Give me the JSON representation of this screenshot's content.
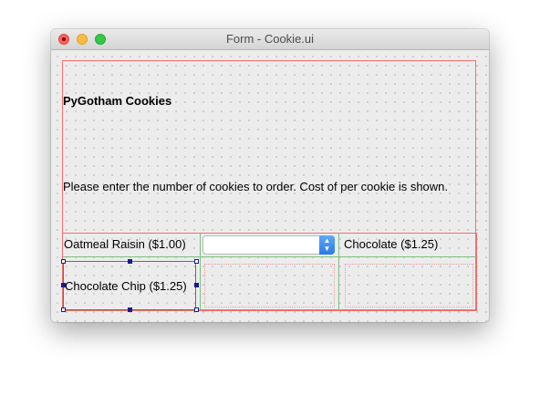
{
  "window": {
    "title": "Form - Cookie.ui"
  },
  "form": {
    "heading": "PyGotham Cookies",
    "instructions": "Please enter the number of cookies to order. Cost of per cookie is shown.",
    "items": [
      {
        "label": "Oatmeal Raisin ($1.00)"
      },
      {
        "label": "Chocolate ($1.25)"
      },
      {
        "label": "Chocolate Chip ($1.25)"
      }
    ],
    "combo_value": ""
  },
  "colors": {
    "layout_outline": "#f0706c",
    "grid_line": "#7cc07c",
    "selection_handle": "#1a1a8a",
    "combo_accent": "#2a79e8"
  }
}
